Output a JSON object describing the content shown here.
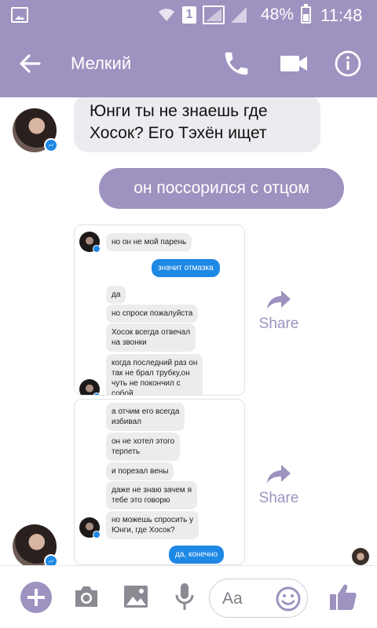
{
  "status_bar": {
    "sim_slot": "1",
    "battery": "48%",
    "time": "11:48"
  },
  "header": {
    "contact_name": "Мелкий"
  },
  "messages": {
    "incoming_text": [
      "Юнги ты не знаешь где",
      "Хосок? Его Тэхён ищет"
    ],
    "outgoing_text": "он поссорился с отцом"
  },
  "screenshots": [
    {
      "incoming_top": [
        "но он не мой парень"
      ],
      "outgoing": [
        "значит отмазка"
      ],
      "incoming": [
        "да",
        "но спроси пожалуйста",
        "Хосок всегда отвечал\nна звонки",
        "когда последний раз он\nтак не брал трубку,он\nчуть не покончил с\nсобой"
      ]
    },
    {
      "incoming": [
        "а отчим его всегда\nизбивал",
        "он не хотел этого\nтерпеть",
        "и порезал вены",
        "даже не знаю зачем я\nтебе это говорю",
        "но можешь спросить у\nЮнги, где Хосок?"
      ],
      "outgoing": [
        "да, конечно"
      ]
    }
  ],
  "share_label": "Share",
  "composer": {
    "placeholder": "Aa"
  },
  "colors": {
    "accent": "#9e92c0",
    "bubble_in": "#ececf0",
    "messenger_blue": "#1e88e5"
  }
}
